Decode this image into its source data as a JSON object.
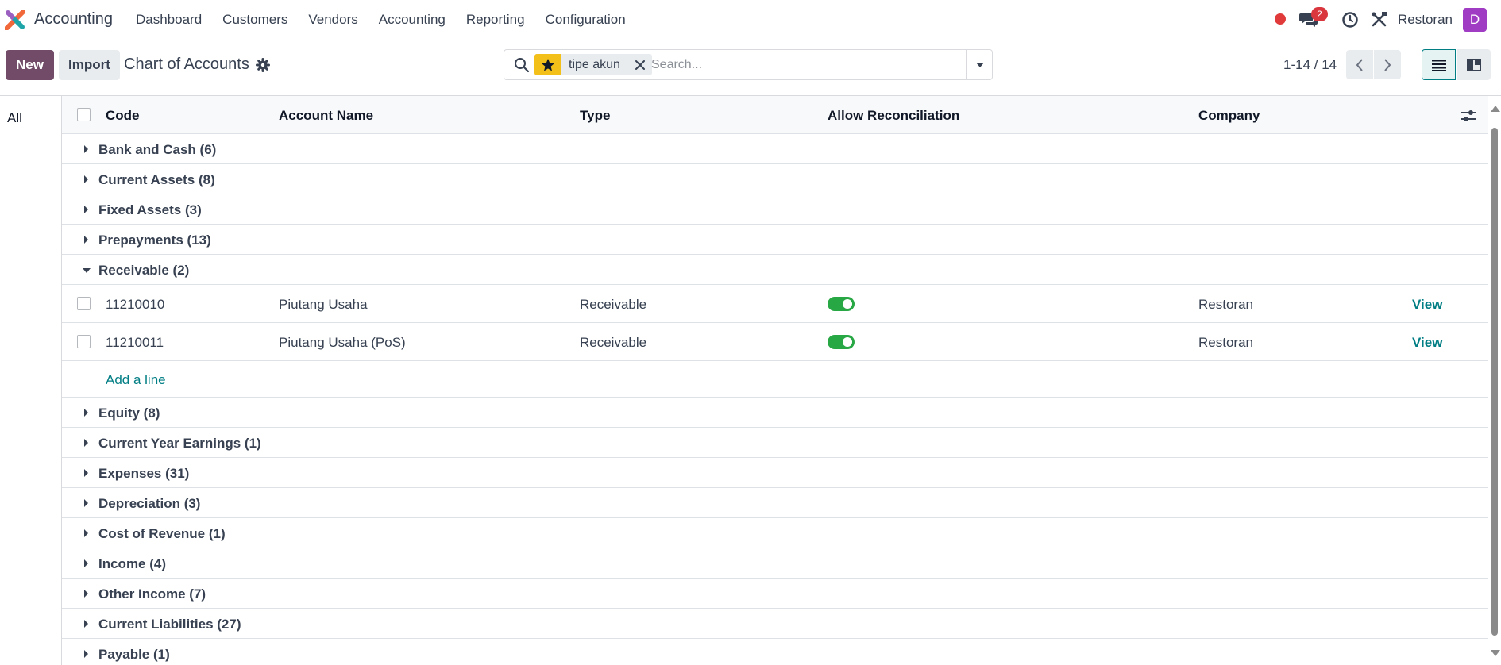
{
  "navbar": {
    "app_name": "Accounting",
    "menu": [
      "Dashboard",
      "Customers",
      "Vendors",
      "Accounting",
      "Reporting",
      "Configuration"
    ],
    "chat_count": "2",
    "company": "Restoran",
    "avatar_letter": "D",
    "record_dot_color": "#e03a3a"
  },
  "control_panel": {
    "new_label": "New",
    "import_label": "Import",
    "title": "Chart of Accounts",
    "search": {
      "facet_icon": "star-icon",
      "facet_label": "tipe akun",
      "placeholder": "Search..."
    },
    "pager": "1-14 / 14"
  },
  "side_panel": {
    "all_label": "All"
  },
  "list": {
    "columns": {
      "code": "Code",
      "account_name": "Account Name",
      "type": "Type",
      "allow_reconciliation": "Allow Reconciliation",
      "company": "Company"
    },
    "groups_before": [
      "Bank and Cash (6)",
      "Current Assets (8)",
      "Fixed Assets (3)",
      "Prepayments (13)"
    ],
    "open_group": "Receivable (2)",
    "rows": [
      {
        "code": "11210010",
        "name": "Piutang Usaha",
        "type": "Receivable",
        "reconcile": true,
        "company": "Restoran",
        "action": "View"
      },
      {
        "code": "11210011",
        "name": "Piutang Usaha (PoS)",
        "type": "Receivable",
        "reconcile": true,
        "company": "Restoran",
        "action": "View"
      }
    ],
    "add_line": "Add a line",
    "groups_after": [
      "Equity (8)",
      "Current Year Earnings (1)",
      "Expenses (31)",
      "Depreciation (3)",
      "Cost of Revenue (1)",
      "Income (4)",
      "Other Income (7)",
      "Current Liabilities (27)",
      "Payable (1)"
    ]
  },
  "colors": {
    "primary": "#714b67",
    "link": "#017e84",
    "toggle_on": "#28a745",
    "facet_star": "#f3c01a"
  }
}
